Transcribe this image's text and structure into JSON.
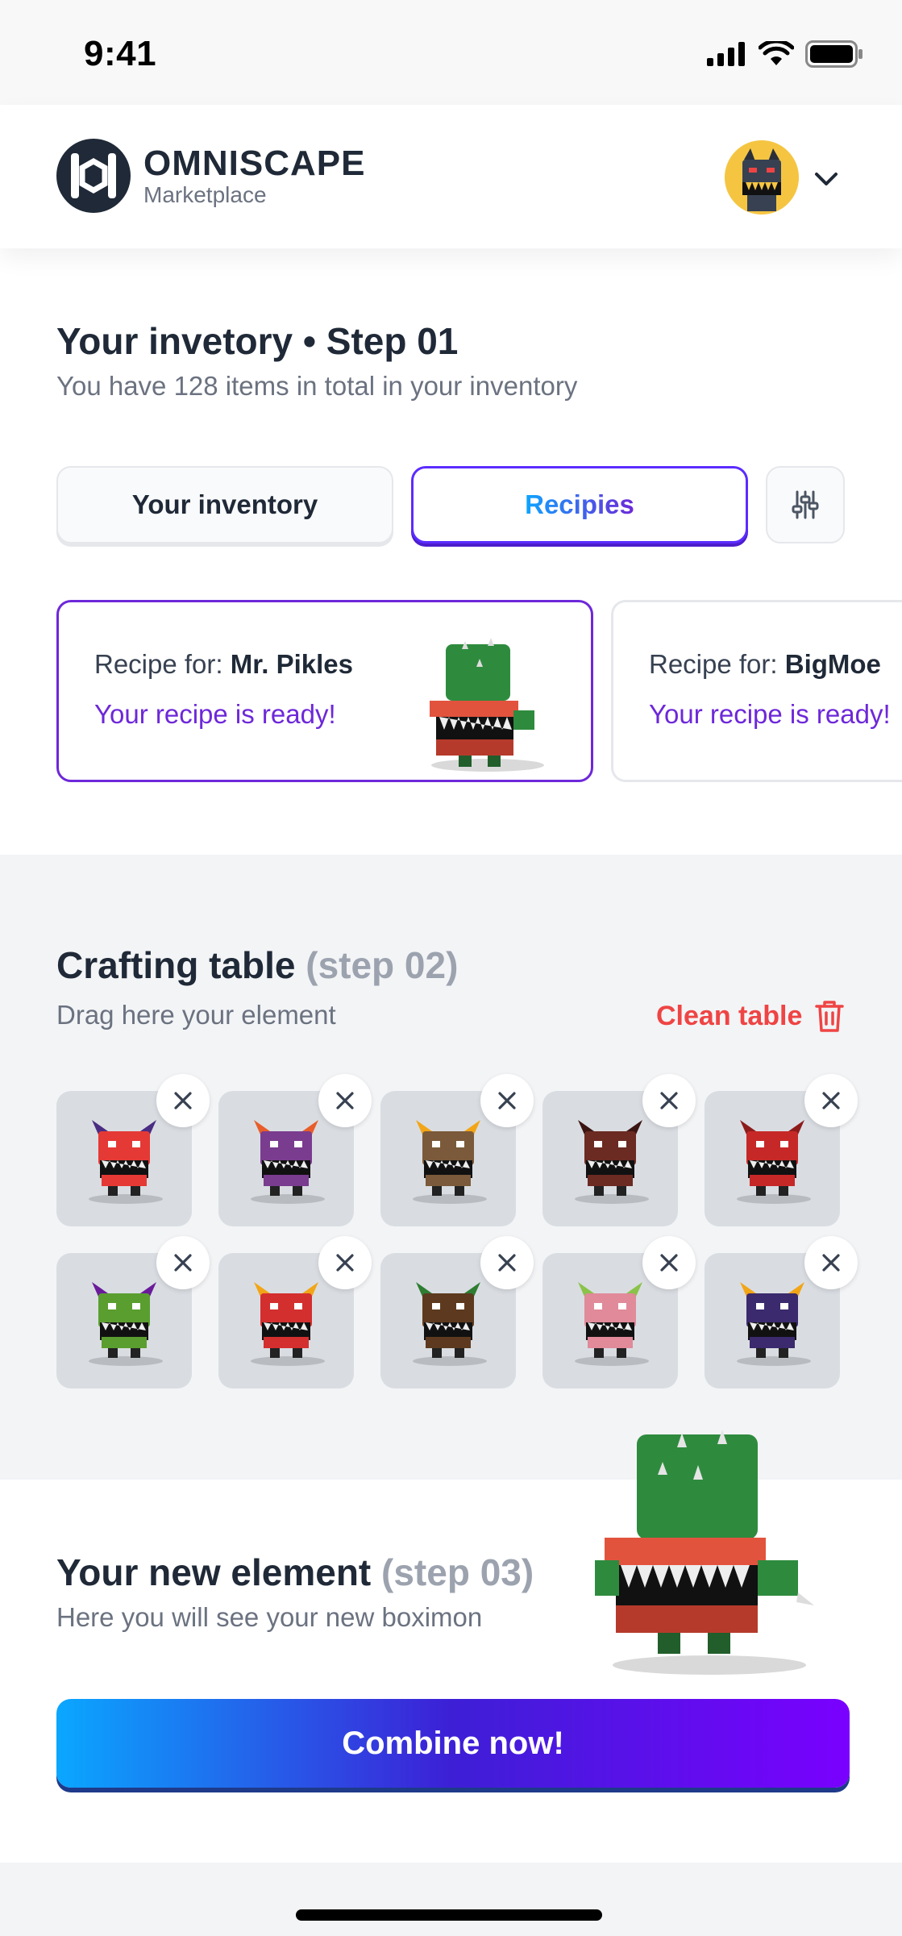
{
  "status_bar": {
    "time": "9:41"
  },
  "header": {
    "brand_name": "OMNISCAPE",
    "brand_sub": "Marketplace"
  },
  "inventory": {
    "title": "Your invetory • Step 01",
    "subtitle": "You have 128 items in total in your inventory",
    "tabs": [
      {
        "label": "Your inventory",
        "active": false
      },
      {
        "label": "Recipies",
        "active": true
      }
    ],
    "recipes": [
      {
        "prefix": "Recipe for:",
        "name": "Mr. Pikles",
        "status": "Your recipe is ready!"
      },
      {
        "prefix": "Recipe for:",
        "name": "BigMoe",
        "status": "Your recipe is ready!"
      }
    ]
  },
  "crafting": {
    "title": "Crafting table",
    "title_step": "(step 02)",
    "subtitle": "Drag here your element",
    "clean_label": "Clean table",
    "slots": [
      {
        "color": "#e53935",
        "accent": "#4a2c82"
      },
      {
        "color": "#7a3c8e",
        "accent": "#e85d2a"
      },
      {
        "color": "#7a5a3a",
        "accent": "#f2a516"
      },
      {
        "color": "#6b2a22",
        "accent": "#3b1512"
      },
      {
        "color": "#c62828",
        "accent": "#8e1b1b"
      },
      {
        "color": "#5a9e2f",
        "accent": "#6a1b9a"
      },
      {
        "color": "#d32f2f",
        "accent": "#f2a516"
      },
      {
        "color": "#5d3a1f",
        "accent": "#2e7d32"
      },
      {
        "color": "#e08a9a",
        "accent": "#8bc34a"
      },
      {
        "color": "#3b2a6e",
        "accent": "#f2a516"
      }
    ]
  },
  "new_element": {
    "title": "Your new element",
    "title_step": "(step 03)",
    "subtitle": "Here you will see your new boximon",
    "button_label": "Combine now!"
  }
}
